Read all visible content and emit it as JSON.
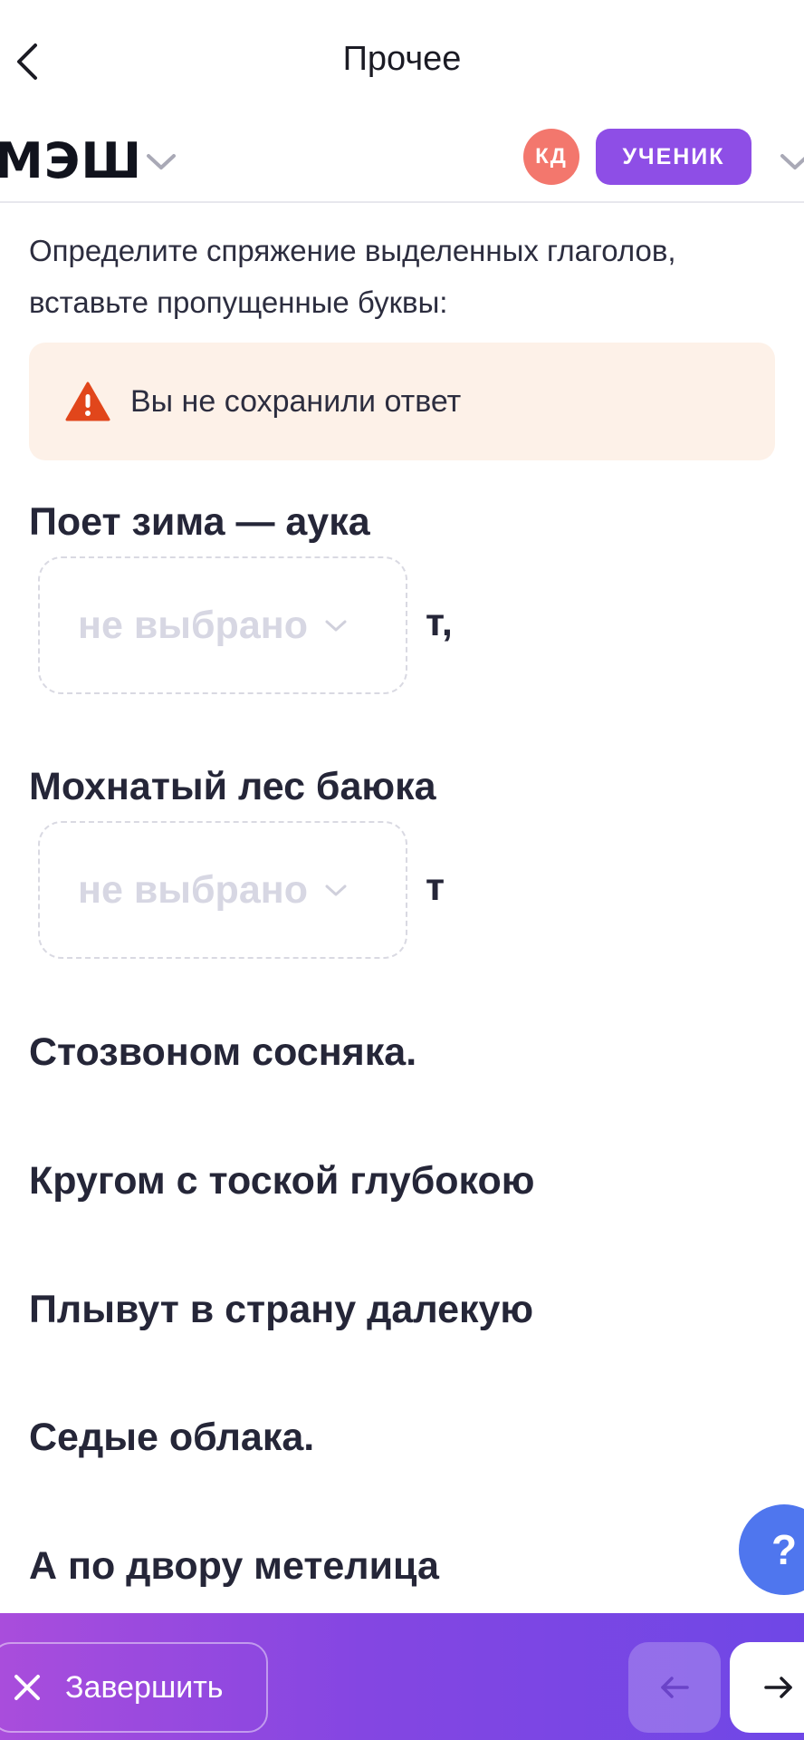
{
  "nav": {
    "title": "Прочее"
  },
  "brand": {
    "logo": "МЭШ"
  },
  "user": {
    "initials": "КД",
    "role": "УЧЕНИК"
  },
  "task": {
    "instruction": "Определите спряжение выделенных глаголов, вставьте пропущенные буквы:",
    "alert_text": "Вы не сохранили ответ"
  },
  "poem": {
    "line1": "Поет зима — аука",
    "select1_value": "не выбрано",
    "suffix1": "т,",
    "line2": "Мохнатый лес баюка",
    "select2_value": "не выбрано",
    "suffix2": "т",
    "line3": "Стозвоном сосняка.",
    "line4": "Кругом с тоской глубокою",
    "line5": "Плывут в страну далекую",
    "line6": "Седые облака.",
    "line7": "А по двору метелица"
  },
  "help": {
    "label": "?"
  },
  "footer": {
    "finish_label": "Завершить"
  },
  "colors": {
    "accent": "#8e4ee6",
    "avatar": "#f3776d",
    "alert_bg": "#fdf1e8",
    "warning": "#e1461b",
    "help": "#4f76ee"
  }
}
